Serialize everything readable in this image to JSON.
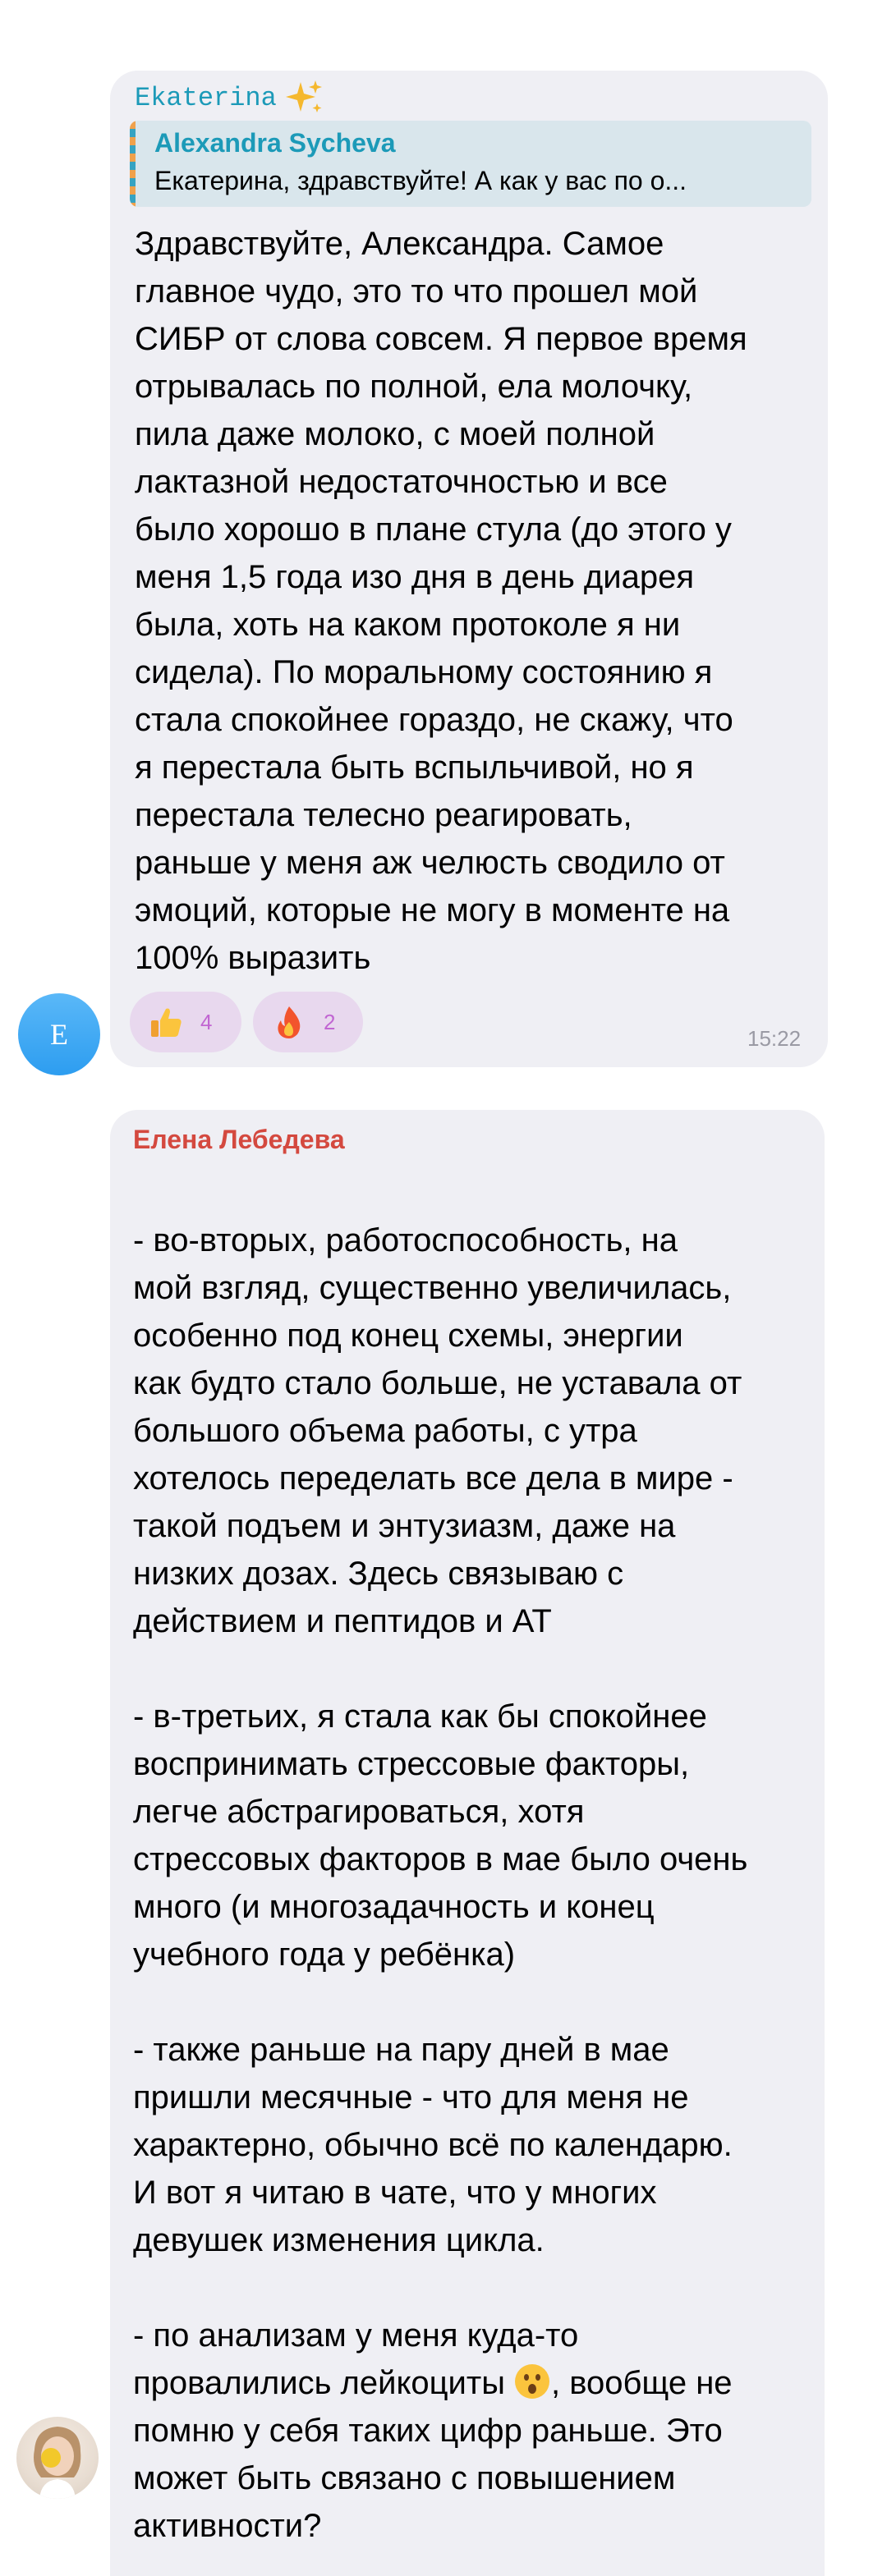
{
  "messages": [
    {
      "sender": "Ekaterina",
      "sender_decoration": "sparkles-emoji",
      "avatar_letter": "E",
      "reply_to": {
        "name": "Alexandra Sycheva",
        "text": "Екатерина, здравствуйте! А как у вас по о..."
      },
      "text": "Здравствуйте, Александра. Самое\nглавное чудо, это то что прошел мой\nСИБР от слова совсем. Я первое время\nотрывалась по полной, ела молочку,\nпила даже молоко, с моей полной\nлактазной недостаточностью и все\nбыло хорошо в плане стула (до этого у\nменя 1,5 года изо дня в день диарея\nбыла, хоть на каком протоколе я ни\nсидела). По моральному состоянию я\nстала спокойнее гораздо, не скажу, что\nя перестала быть вспыльчивой, но я\nперестала телесно реагировать,\nраньше у меня аж челюсть сводило от\nэмоций, которые не могу в моменте на\n100% выразить",
      "reactions": [
        {
          "emoji": "thumbs-up-icon",
          "count": "4"
        },
        {
          "emoji": "fire-icon",
          "count": "2"
        }
      ],
      "time": "15:22"
    },
    {
      "sender": "Елена Лебедева",
      "text": "- во-вторых, работоспособность, на\nмой взгляд, существенно увеличилась,\nособенно под конец схемы, энергии\nкак будто стало больше, не уставала от\nбольшого объема работы, с утра\nхотелось переделать все дела в мире -\nтакой подъем и энтузиазм, даже на\nнизких дозах. Здесь связываю с\nдействием и пептидов и АТ\n\n- в-третьих, я стала как бы спокойнее\nвоспринимать стрессовые факторы,\nлегче абстрагироваться, хотя\nстрессовых факторов в мае было очень\nмного (и многозадачность и конец\nучебного года у ребёнка)\n\n- также раньше на пару дней в мае\nпришли месячные - что для меня не\nхарактерно, обычно всё по календарю.\nИ вот я читаю в чате, что у многих\nдевушек изменения цикла.\n\n- по анализам у меня куда-то\nпровалились лейкоциты",
      "text_after_emoji": ", вообще не\nпомню у себя таких цифр раньше. Это\nможет быть связано с повышением\nактивности?",
      "inline_emoji": "surprised-face-icon"
    }
  ],
  "colors": {
    "bubble": "#efeff4",
    "sender1": "#1c9ab8",
    "sender2": "#d4493f",
    "reply_bg": "#d9e6ec",
    "reaction_bg": "#e8d8ee",
    "reaction_count": "#c166d2",
    "time": "#9a9aa4",
    "avatar": "#2d9df0"
  }
}
